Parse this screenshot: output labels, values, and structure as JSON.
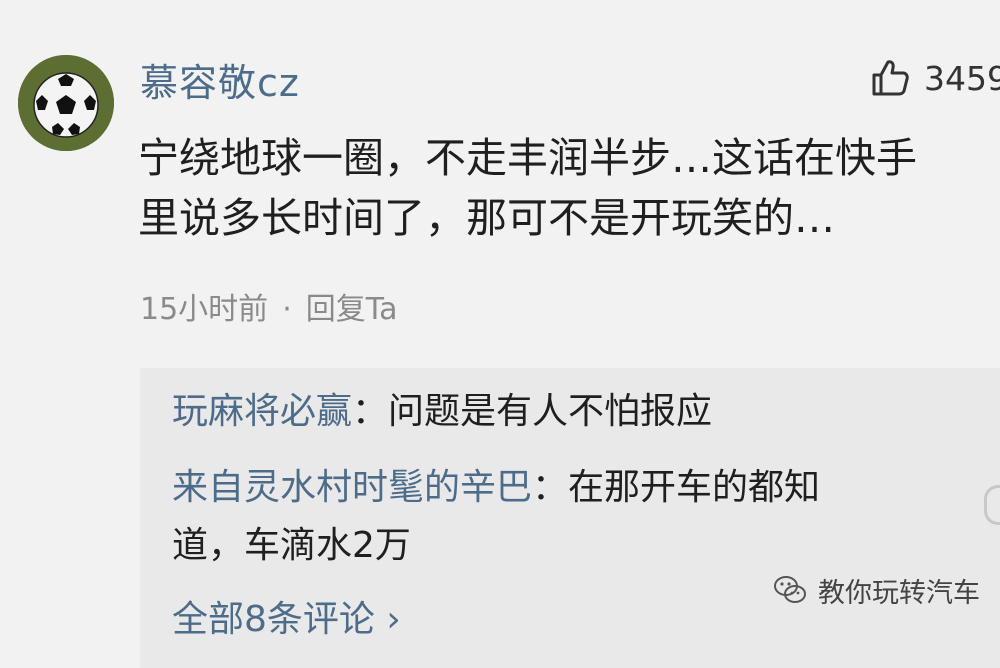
{
  "comment": {
    "username": "慕容敬cz",
    "like_count": "3459",
    "text_line1": "宁绕地球一圈，不走丰润半步…这话在快手",
    "text_line2": "里说多长时间了，那可不是开玩笑的…",
    "time": "15小时前",
    "separator": "·",
    "reply_action": "回复Ta"
  },
  "replies": [
    {
      "author": "玩麻将必赢",
      "colon": "：",
      "text": "问题是有人不怕报应"
    },
    {
      "author": "来自灵水村时髦的辛巴",
      "colon": "：",
      "text": "在那开车的都知",
      "text_cont": "道，车滴水2万"
    }
  ],
  "all_comments_label": "全部8条评论 ›",
  "watermark": {
    "text": "教你玩转汽车",
    "icon": "wechat-icon"
  },
  "icons": {
    "like": "thumbs-up-icon",
    "avatar": "soccer-ball-avatar"
  },
  "colors": {
    "username": "#4d6c8a",
    "background": "#f2f2f2",
    "reply_bg": "#e9e9e9"
  }
}
